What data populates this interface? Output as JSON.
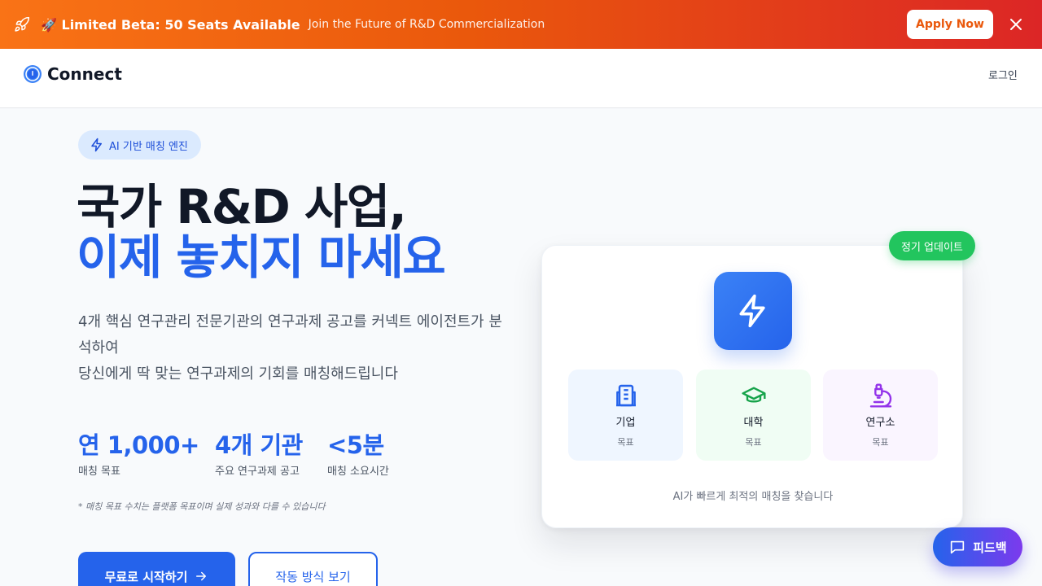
{
  "banner": {
    "title": "🚀 Limited Beta: 50 Seats Available",
    "subtitle": "Join the Future of R&D Commercialization",
    "apply_label": "Apply Now",
    "icons": {
      "left": "rocket-icon",
      "close": "close-icon"
    }
  },
  "header": {
    "logo_text": "Connect",
    "login_label": "로그인"
  },
  "hero": {
    "pill_label": "AI 기반 매칭 엔진",
    "title_line1": "국가 R&D 사업,",
    "title_line2": "이제 놓치지 마세요",
    "desc_line1": "4개 핵심 연구관리 전문기관의 연구과제 공고를 커넥트 에이전트가 분석하여",
    "desc_line2": "당신에게 딱 맞는 연구과제의 기회를 매칭해드립니다",
    "stats": [
      {
        "value": "연 1,000+",
        "label": "매칭 목표"
      },
      {
        "value": "4개 기관",
        "label": "주요 연구과제 공고"
      },
      {
        "value": "<5분",
        "label": "매칭 소요시간"
      }
    ],
    "note": "* 매칭 목표 수치는 플랫폼 목표이며 실제 성과와 다를 수 있습니다",
    "cta_primary": "무료로 시작하기",
    "cta_secondary": "작동 방식 보기"
  },
  "card": {
    "badge": "정기 업데이트",
    "tiles": [
      {
        "title": "기업",
        "sub": "목표",
        "icon": "building-icon"
      },
      {
        "title": "대학",
        "sub": "목표",
        "icon": "graduation-cap-icon"
      },
      {
        "title": "연구소",
        "sub": "목표",
        "icon": "microscope-icon"
      }
    ],
    "footer": "AI가 빠르게 최적의 매칭을 찾습니다"
  },
  "feedback_label": "피드백",
  "colors": {
    "brand_blue": "#2563eb",
    "banner_orange": "#f97316",
    "banner_red": "#dc2626",
    "badge_green": "#22c55e",
    "feedback_purple": "#7c3aed"
  }
}
